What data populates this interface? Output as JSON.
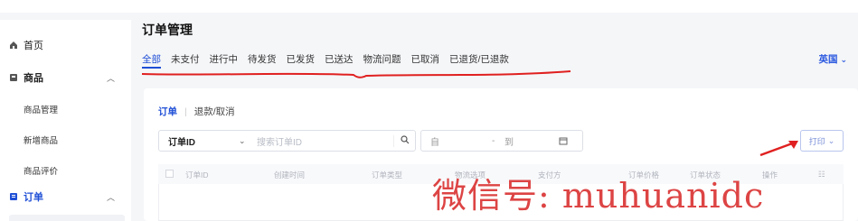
{
  "sidebar": {
    "items": [
      {
        "label": "首页"
      },
      {
        "label": "商品"
      },
      {
        "label": "订单"
      }
    ],
    "product_subitems": [
      "商品管理",
      "新增商品",
      "商品评价"
    ]
  },
  "main": {
    "title": "订单管理",
    "tabs": [
      "全部",
      "未支付",
      "进行中",
      "待发货",
      "已发货",
      "已送达",
      "物流问题",
      "已取消",
      "已退货/已退款"
    ],
    "country": "英国",
    "subtabs": [
      "订单",
      "退款/取消"
    ],
    "filter": {
      "select_value": "订单ID",
      "search_placeholder": "搜索订单ID",
      "date_from": "自",
      "date_to": "到"
    },
    "print_label": "打印",
    "table_headers": [
      "订单ID",
      "创建时间",
      "订单类型",
      "物流选项",
      "支付方",
      "订单价格",
      "订单状态",
      "操作"
    ]
  },
  "watermark": "微信号: muhuanidc",
  "colors": {
    "accent": "#1f4fd6",
    "annotation_red": "#e02020"
  }
}
